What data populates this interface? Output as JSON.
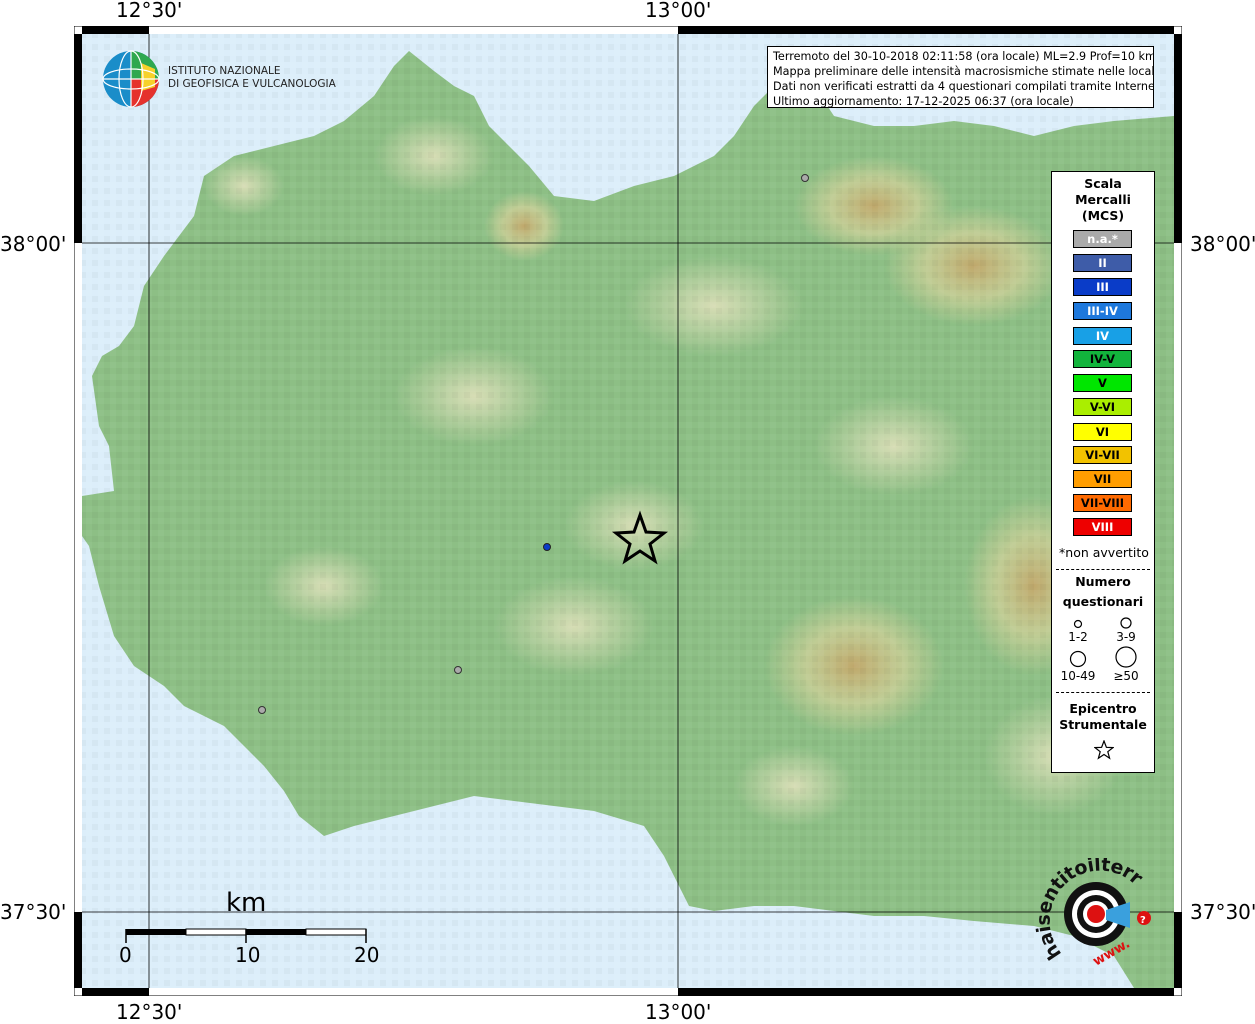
{
  "axes": {
    "top_left": "12°30'",
    "top_right": "13°00'",
    "bottom_left": "12°30'",
    "bottom_right": "13°00'",
    "left_top": "38°00'",
    "left_bottom": "37°30'",
    "right_top": "38°00'",
    "right_bottom": "37°30'"
  },
  "logo": {
    "line1": "ISTITUTO NAZIONALE",
    "line2": "DI GEOFISICA E VULCANOLOGIA"
  },
  "info": {
    "line1": "Terremoto del 30-10-2018 02:11:58 (ora locale) ML=2.9 Prof=10 km",
    "line2": "Mappa preliminare delle intensità macrosismiche stimate nelle località",
    "line3": "Dati non verificati estratti da 4 questionari compilati tramite Internet.",
    "line4": "Ultimo aggiornamento: 17-12-2025 06:37 (ora locale)"
  },
  "legend": {
    "title1": "Scala",
    "title2": "Mercalli",
    "title3": "(MCS)",
    "scale": [
      {
        "label": "n.a.*",
        "color": "#aaaaaa",
        "text": "#ffffff"
      },
      {
        "label": "II",
        "color": "#3e5ca8",
        "text": "#ffffff"
      },
      {
        "label": "III",
        "color": "#0a3cc8",
        "text": "#ffffff"
      },
      {
        "label": "III-IV",
        "color": "#1e78dc",
        "text": "#ffffff"
      },
      {
        "label": "IV",
        "color": "#18a0e6",
        "text": "#ffffff"
      },
      {
        "label": "IV-V",
        "color": "#12b43c",
        "text": "#000000"
      },
      {
        "label": "V",
        "color": "#00e600",
        "text": "#000000"
      },
      {
        "label": "V-VI",
        "color": "#aaee00",
        "text": "#000000"
      },
      {
        "label": "VI",
        "color": "#ffff00",
        "text": "#000000"
      },
      {
        "label": "VI-VII",
        "color": "#f2c200",
        "text": "#000000"
      },
      {
        "label": "VII",
        "color": "#ff9d00",
        "text": "#000000"
      },
      {
        "label": "VII-VIII",
        "color": "#ff6a00",
        "text": "#000000"
      },
      {
        "label": "VIII",
        "color": "#ee0000",
        "text": "#ffffff"
      }
    ],
    "not_felt": "*non avvertito",
    "count_title1": "Numero",
    "count_title2": "questionari",
    "count1": "1-2",
    "count2": "3-9",
    "count3": "10-49",
    "count4": "≥50",
    "epi1": "Epicentro",
    "epi2": "Strumentale"
  },
  "scalebar": {
    "unit": "km",
    "t0": "0",
    "t1": "10",
    "t2": "20"
  },
  "brand": {
    "text": "haisentitoilterremoto.it",
    "www": "www."
  },
  "colors": {
    "sea": "#dceefa",
    "land": "#8dbf85",
    "hills": "#d6d09a",
    "epicentre_star": "#000000"
  }
}
